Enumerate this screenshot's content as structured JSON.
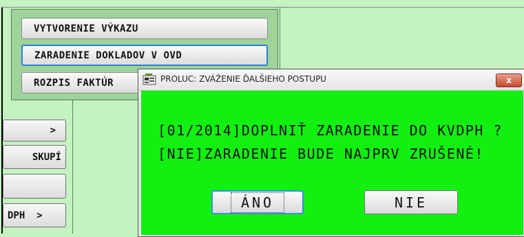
{
  "menu": {
    "items": [
      {
        "label": "VYTVORENIE VÝKAZU"
      },
      {
        "label": "ZARADENIE DOKLADOV V OVD"
      },
      {
        "label": "ROZPIS FAKTÚR"
      }
    ]
  },
  "side_buttons": [
    {
      "label": ">"
    },
    {
      "label": "SKUPÍ"
    },
    {
      "label": ""
    },
    {
      "label": "DPH  >"
    }
  ],
  "dialog": {
    "title": "PROLUC: ZVÁŽENIE ĎALŠIEHO POSTUPU",
    "close_label": "x",
    "message_line1": "[01/2014]DOPLNIŤ ZARADENIE DO KVDPH ?",
    "message_line2": "[NIE]ZARADENIE BUDE NAJPRV ZRUŠENÉ!",
    "yes_label": "ÁNO",
    "no_label": "NIE"
  },
  "colors": {
    "background": "#c4f2c1",
    "dialog_content": "#12f012",
    "menu_panel": "#9ed39a",
    "selection_border": "#2b80d8"
  }
}
